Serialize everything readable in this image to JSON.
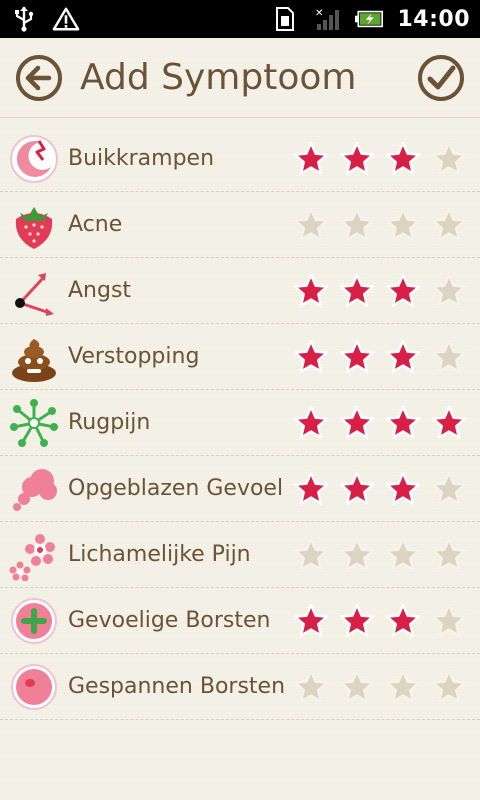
{
  "status_bar": {
    "time": "14:00",
    "icons": [
      "usb-icon",
      "warning-icon",
      "sim-icon",
      "signal-icon",
      "battery-charging-icon"
    ]
  },
  "header": {
    "title": "Add Symptoom",
    "back_icon": "back-arrow-icon",
    "confirm_icon": "checkmark-icon"
  },
  "colors": {
    "star_on": "#d81f47",
    "star_off": "#dcd4c3",
    "text": "#6b5336",
    "background": "#f2efe4"
  },
  "symptoms": [
    {
      "label": "Buikkrampen",
      "icon": "cramp-moon-icon",
      "rating": 3
    },
    {
      "label": "Acne",
      "icon": "strawberry-icon",
      "rating": 0
    },
    {
      "label": "Angst",
      "icon": "clock-hands-icon",
      "rating": 3
    },
    {
      "label": "Verstopping",
      "icon": "poop-icon",
      "rating": 3
    },
    {
      "label": "Rugpijn",
      "icon": "green-burst-icon",
      "rating": 4
    },
    {
      "label": "Opgeblazen Gevoel",
      "icon": "cloud-puff-icon",
      "rating": 3
    },
    {
      "label": "Lichamelijke Pijn",
      "icon": "pink-flowers-icon",
      "rating": 0
    },
    {
      "label": "Gevoelige Borsten",
      "icon": "plus-circle-icon",
      "rating": 3
    },
    {
      "label": "Gespannen Borsten",
      "icon": "pink-circle-icon",
      "rating": 0
    }
  ],
  "max_rating": 4
}
